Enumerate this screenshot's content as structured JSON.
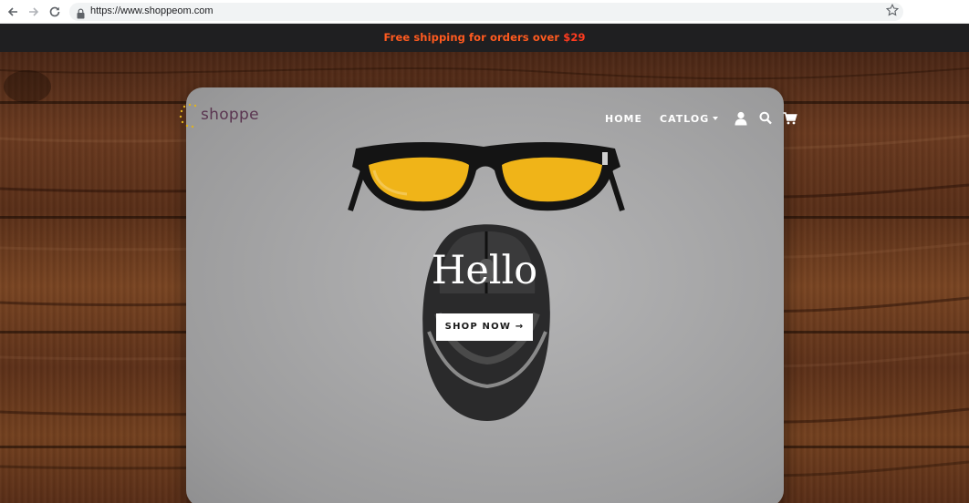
{
  "browser": {
    "url": "https://www.shoppeom.com",
    "icons": [
      "back-arrow-icon",
      "forward-arrow-icon",
      "reload-icon",
      "lock-icon",
      "star-icon"
    ]
  },
  "announcement": {
    "text": "Free shipping for orders over ",
    "price": "$29",
    "color": "#ff5a1f",
    "background": "#1f1f21"
  },
  "header": {
    "logo_text": "shoppe",
    "nav": {
      "home": "HOME",
      "catalog": "CATLOG"
    },
    "icons": [
      "user-icon",
      "search-icon",
      "cart-icon"
    ]
  },
  "hero": {
    "title": "Hello",
    "cta_label": "SHOP NOW →"
  },
  "colors": {
    "logo": "#5a3550",
    "laptop": "#a6a6a7",
    "wood": "#6b3a1f",
    "lens": "#f0b418"
  }
}
